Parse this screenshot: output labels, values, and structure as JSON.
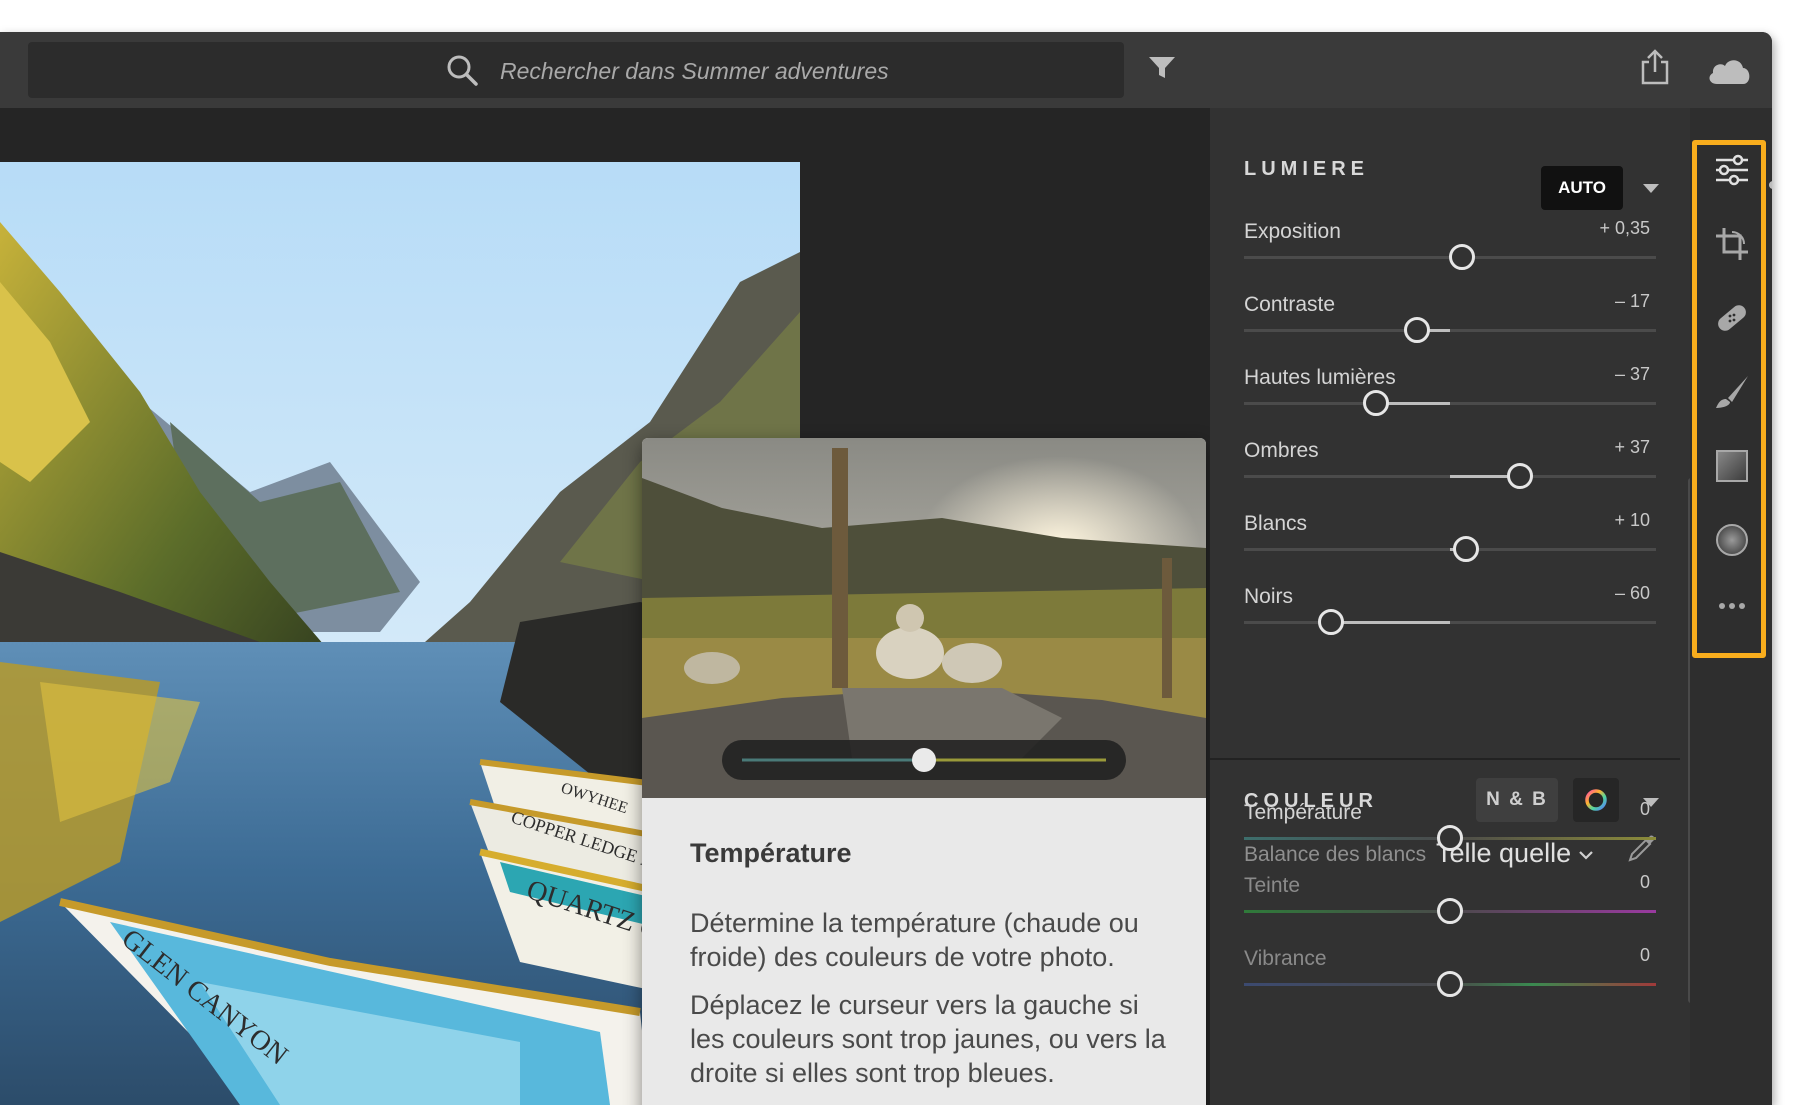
{
  "search": {
    "placeholder": "Rechercher dans Summer adventures"
  },
  "icons": {
    "search": "search-icon",
    "filter": "filter-icon",
    "share": "share-icon",
    "cloud": "cloud-icon",
    "tools": [
      "edit-sliders-icon",
      "crop-icon",
      "healing-bandage-icon",
      "brush-icon",
      "linear-gradient-icon",
      "radial-gradient-icon",
      "more-icon"
    ]
  },
  "photo": {
    "boat_labels": [
      "GLEN CANYON",
      "OWYHEE",
      "COPPER LEDGE FA",
      "QUARTZ C"
    ]
  },
  "tooltip": {
    "title": "Température",
    "paragraph1": "Détermine la température (chaude ou froide) des couleurs de votre photo.",
    "paragraph2": "Déplacez le curseur vers la gauche si les couleurs sont trop jaunes, ou vers la droite si elles sont trop bleues.",
    "demo_slider_level": 0.5
  },
  "light": {
    "title": "LUMIERE",
    "auto_label": "AUTO",
    "sliders": [
      {
        "label": "Exposition",
        "value": "+ 0,35",
        "level": 0.53
      },
      {
        "label": "Contraste",
        "value": "– 17",
        "level": 0.42
      },
      {
        "label": "Hautes lumières",
        "value": "– 37",
        "level": 0.32
      },
      {
        "label": "Ombres",
        "value": "+ 37",
        "level": 0.67
      },
      {
        "label": "Blancs",
        "value": "+ 10",
        "level": 0.54
      },
      {
        "label": "Noirs",
        "value": "– 60",
        "level": 0.21
      }
    ]
  },
  "color": {
    "title": "COULEUR",
    "bw_label": "N & B",
    "wb_label": "Balance des blancs",
    "wb_value": "Telle quelle",
    "sliders": [
      {
        "label": "Température",
        "value": "0",
        "level": 0.5
      },
      {
        "label": "Teinte",
        "value": "0",
        "level": 0.5
      },
      {
        "label": "Vibrance",
        "value": "0",
        "level": 0.5
      }
    ]
  },
  "colors": {
    "accent_highlight": "#f8ad1d",
    "panel_bg": "#323232",
    "topbar_bg": "#3a3a3a"
  }
}
